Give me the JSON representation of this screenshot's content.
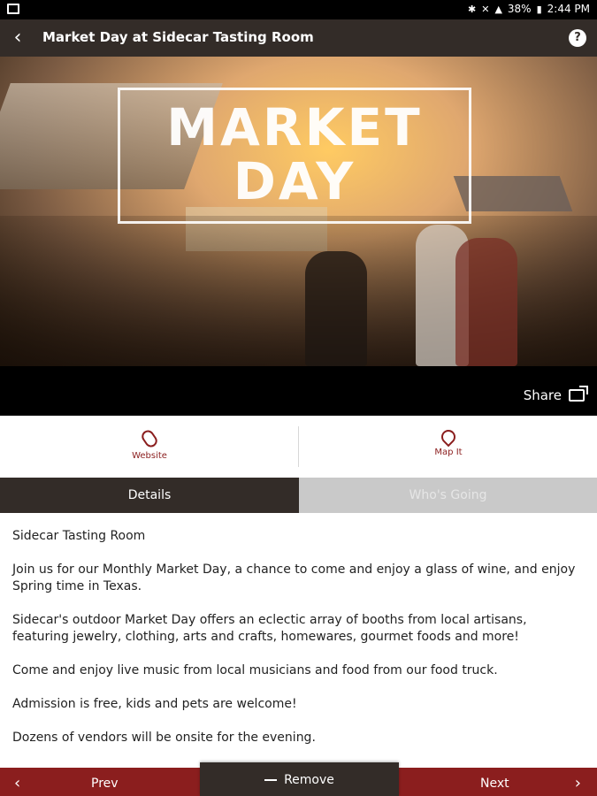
{
  "status_bar": {
    "battery": "38%",
    "time": "2:44 PM"
  },
  "app_bar": {
    "title": "Market Day at Sidecar Tasting Room",
    "help": "?"
  },
  "hero": {
    "line1": "MARKET",
    "line2": "DAY"
  },
  "share": {
    "label": "Share"
  },
  "actions": {
    "website": "Website",
    "map": "Map It"
  },
  "tabs": {
    "details": "Details",
    "whos_going": "Who's Going"
  },
  "content": {
    "paragraphs": [
      "Sidecar Tasting Room",
      "Join us for our Monthly Market Day, a chance to come and enjoy a glass of wine, and enjoy Spring time in Texas.",
      "Sidecar's outdoor Market Day offers an eclectic array of booths from local artisans, featuring jewelry, clothing, arts and crafts, homewares, gourmet foods and more!",
      "Come and enjoy live music from local musicians and food from our food truck.",
      "Admission is free, kids and pets are welcome!",
      "Dozens of vendors will be onsite for the evening."
    ]
  },
  "bottom_nav": {
    "prev": "Prev",
    "remove": "Remove",
    "next": "Next"
  },
  "colors": {
    "header": "#332c28",
    "accent": "#8b1e1e",
    "inactive_tab": "#c9c9c9"
  }
}
